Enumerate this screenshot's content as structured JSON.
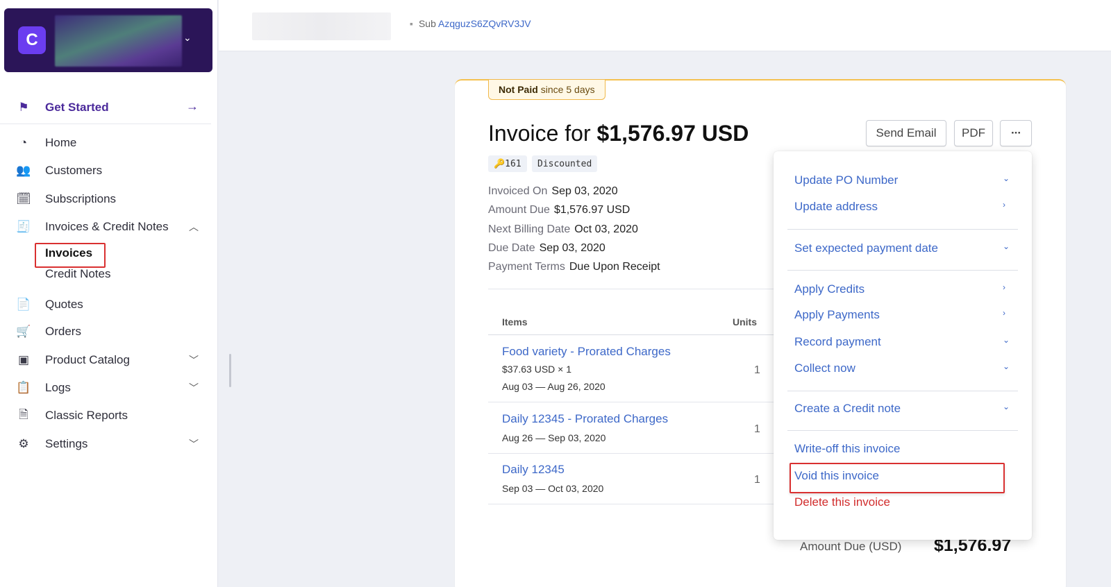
{
  "topbar": {
    "sub_label": "Sub",
    "sub_id": "AzqguzS6ZQvRV3JV"
  },
  "sidebar": {
    "get_started": "Get Started",
    "items": [
      {
        "label": "Home",
        "icon": "dashboard-icon"
      },
      {
        "label": "Customers",
        "icon": "users-icon"
      },
      {
        "label": "Subscriptions",
        "icon": "calendar-clock-icon"
      },
      {
        "label": "Invoices & Credit Notes",
        "icon": "invoice-icon",
        "expanded": true
      },
      {
        "label": "Quotes",
        "icon": "quote-icon"
      },
      {
        "label": "Orders",
        "icon": "cart-icon"
      },
      {
        "label": "Product Catalog",
        "icon": "catalog-icon"
      },
      {
        "label": "Logs",
        "icon": "clipboard-icon"
      },
      {
        "label": "Classic Reports",
        "icon": "report-icon"
      },
      {
        "label": "Settings",
        "icon": "gear-icon"
      }
    ],
    "subitems": {
      "invoices": "Invoices",
      "credit_notes": "Credit Notes"
    }
  },
  "invoice": {
    "status_bold": "Not Paid",
    "status_rest": "since 5 days",
    "title_prefix": "Invoice for",
    "title_amount": "$1,576.97 USD",
    "tags": [
      "🔑161",
      "Discounted"
    ],
    "buttons": {
      "send_email": "Send Email",
      "pdf": "PDF",
      "more": "···"
    },
    "meta": [
      {
        "k": "Invoiced On",
        "v": "Sep 03, 2020"
      },
      {
        "k": "Amount Due",
        "v": "$1,576.97 USD"
      },
      {
        "k": "Next Billing Date",
        "v": "Oct 03, 2020"
      },
      {
        "k": "Due Date",
        "v": "Sep 03, 2020"
      },
      {
        "k": "Payment Terms",
        "v": "Due Upon Receipt"
      }
    ],
    "table": {
      "headers": {
        "items": "Items",
        "units": "Units"
      },
      "rows": [
        {
          "title": "Food variety - Prorated Charges",
          "price": "$37.63 USD × 1",
          "period": "Aug 03 — Aug 26, 2020",
          "units": "1"
        },
        {
          "title": "Daily 12345 - Prorated Charges",
          "period": "Aug 26 — Sep 03, 2020",
          "units": "1"
        },
        {
          "title": "Daily 12345",
          "period": "Sep 03 — Oct 03, 2020",
          "units": "1"
        }
      ]
    },
    "amount_due_label": "Amount Due (USD)",
    "amount_due_value": "$1,576.97"
  },
  "menu": {
    "items": [
      "Update PO Number",
      "Update address",
      "Set expected payment date",
      "Apply Credits",
      "Apply Payments",
      "Record payment",
      "Collect now",
      "Create a Credit note",
      "Write-off this invoice",
      "Void this invoice",
      "Delete this invoice"
    ]
  },
  "colors": {
    "accent": "#4b2a9b",
    "link": "#3d68c8",
    "danger": "#d12c2c",
    "warning": "#f0b84a"
  }
}
